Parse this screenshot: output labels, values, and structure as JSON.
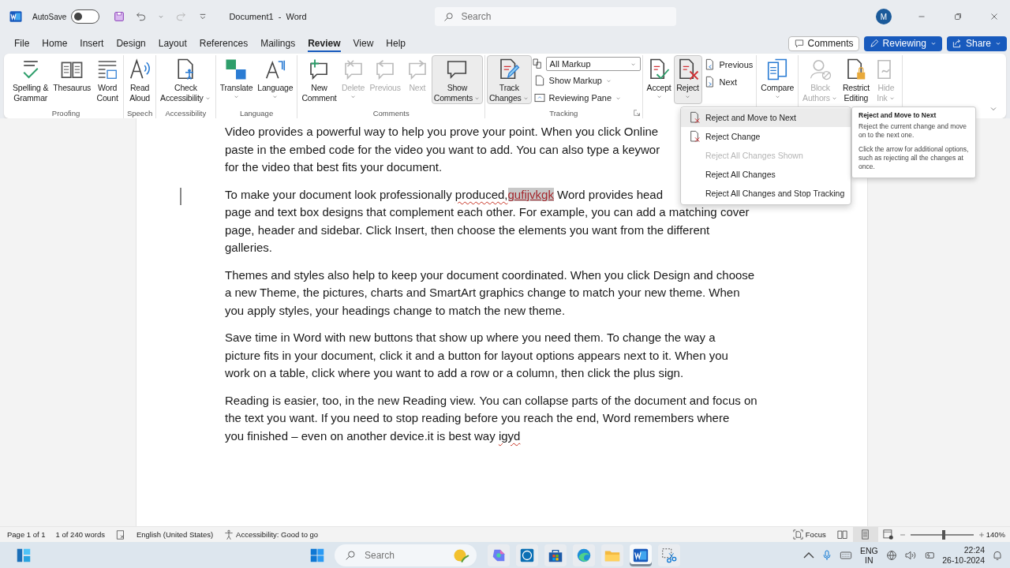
{
  "title_bar": {
    "autosave_label": "AutoSave",
    "autosave_on": false,
    "document_title": "Document1  -  Word",
    "search_placeholder": "Search",
    "account_initial": "M"
  },
  "menu_tabs": [
    {
      "label": "File",
      "selected": false
    },
    {
      "label": "Home",
      "selected": false
    },
    {
      "label": "Insert",
      "selected": false
    },
    {
      "label": "Design",
      "selected": false
    },
    {
      "label": "Layout",
      "selected": false
    },
    {
      "label": "References",
      "selected": false
    },
    {
      "label": "Mailings",
      "selected": false
    },
    {
      "label": "Review",
      "selected": true
    },
    {
      "label": "View",
      "selected": false
    },
    {
      "label": "Help",
      "selected": false
    }
  ],
  "header_buttons": [
    {
      "kind": "outline",
      "label": "Comments",
      "dropdown": false
    },
    {
      "kind": "primary",
      "label": "Reviewing",
      "dropdown": true
    },
    {
      "kind": "primary",
      "label": "Share",
      "dropdown": true
    }
  ],
  "ribbon_groups": [
    {
      "label": "Proofing",
      "items": [
        {
          "kind": "large",
          "lines": [
            "Spelling &",
            "Grammar"
          ],
          "dropdown": false,
          "disabled": false,
          "pressed": false
        },
        {
          "kind": "large",
          "lines": [
            "Thesaurus"
          ],
          "dropdown": false,
          "disabled": false,
          "pressed": false
        },
        {
          "kind": "large",
          "lines": [
            "Word",
            "Count"
          ],
          "dropdown": false,
          "disabled": false,
          "pressed": false
        }
      ]
    },
    {
      "label": "Speech",
      "items": [
        {
          "kind": "large",
          "lines": [
            "Read",
            "Aloud"
          ],
          "dropdown": false,
          "disabled": false,
          "pressed": false
        }
      ]
    },
    {
      "label": "Accessibility",
      "items": [
        {
          "kind": "large",
          "lines": [
            "Check",
            "Accessibility"
          ],
          "dropdown": true,
          "disabled": false,
          "pressed": false
        }
      ]
    },
    {
      "label": "Language",
      "items": [
        {
          "kind": "large",
          "lines": [
            "Translate"
          ],
          "dropdown": true,
          "disabled": false,
          "pressed": false
        },
        {
          "kind": "large",
          "lines": [
            "Language"
          ],
          "dropdown": true,
          "disabled": false,
          "pressed": false
        }
      ]
    },
    {
      "label": "Comments",
      "items": [
        {
          "kind": "large",
          "lines": [
            "New",
            "Comment"
          ],
          "dropdown": false,
          "disabled": false,
          "pressed": false
        },
        {
          "kind": "large",
          "lines": [
            "Delete"
          ],
          "dropdown": true,
          "disabled": true,
          "pressed": false
        },
        {
          "kind": "large",
          "lines": [
            "Previous"
          ],
          "dropdown": false,
          "disabled": true,
          "pressed": false
        },
        {
          "kind": "large",
          "lines": [
            "Next"
          ],
          "dropdown": false,
          "disabled": true,
          "pressed": false
        },
        {
          "kind": "large",
          "lines": [
            "Show",
            "Comments"
          ],
          "dropdown": true,
          "disabled": false,
          "pressed": true
        }
      ]
    },
    {
      "label": "Tracking",
      "launcher": true,
      "items": [
        {
          "kind": "large",
          "lines": [
            "Track",
            "Changes"
          ],
          "dropdown": true,
          "disabled": false,
          "pressed": true
        },
        {
          "kind": "stack",
          "items": [
            {
              "kind": "select",
              "label": "All Markup"
            },
            {
              "kind": "small",
              "label": "Show Markup",
              "caret": true
            },
            {
              "kind": "small",
              "label": "Reviewing Pane",
              "caret": true
            }
          ]
        }
      ]
    },
    {
      "items": [
        {
          "kind": "large",
          "lines": [
            "Accept"
          ],
          "dropdown": true,
          "disabled": false,
          "pressed": false
        },
        {
          "kind": "large",
          "lines": [
            "Reject"
          ],
          "dropdown": true,
          "disabled": false,
          "pressed": true
        },
        {
          "kind": "stack",
          "items": [
            {
              "kind": "small",
              "label": "Previous",
              "caret": false
            },
            {
              "kind": "small",
              "label": "Next",
              "caret": false
            }
          ]
        }
      ]
    },
    {
      "items": [
        {
          "kind": "large",
          "lines": [
            "Compare"
          ],
          "dropdown": true,
          "disabled": false,
          "pressed": false
        }
      ]
    },
    {
      "items": [
        {
          "kind": "large",
          "lines": [
            "Block",
            "Authors"
          ],
          "dropdown": true,
          "disabled": true,
          "pressed": false
        },
        {
          "kind": "large",
          "lines": [
            "Restrict",
            "Editing"
          ],
          "dropdown": false,
          "disabled": false,
          "pressed": false
        },
        {
          "kind": "large",
          "lines": [
            "Hide",
            "Ink"
          ],
          "dropdown": true,
          "disabled": true,
          "pressed": false
        }
      ]
    }
  ],
  "reject_menu": {
    "items": [
      {
        "label": "Reject and Move to Next",
        "has_icon": true,
        "disabled": false,
        "selected": true
      },
      {
        "label": "Reject Change",
        "has_icon": true,
        "disabled": false,
        "selected": false
      },
      {
        "label": "Reject All Changes Shown",
        "has_icon": false,
        "disabled": true,
        "selected": false
      },
      {
        "label": "Reject All Changes",
        "has_icon": false,
        "disabled": false,
        "selected": false
      },
      {
        "label": "Reject All Changes and Stop Tracking",
        "has_icon": false,
        "disabled": false,
        "selected": false
      }
    ]
  },
  "tooltip": {
    "title": "Reject and Move to Next",
    "paragraphs": [
      "Reject the current change and move on to the next one.",
      "Click the arrow for additional options, such as rejecting all the changes at once."
    ]
  },
  "document": {
    "paragraphs": [
      {
        "changed": false,
        "lines": [
          [
            {
              "kind": "text",
              "text": "Video provides a powerful way to help you prove your point. When you click Online"
            }
          ],
          [
            {
              "kind": "text",
              "text": "paste in the embed code for the video you want to add. You can also type a keywor"
            }
          ],
          [
            {
              "kind": "text",
              "text": "for the video that best fits your document."
            }
          ]
        ]
      },
      {
        "changed": true,
        "lines": [
          [
            {
              "kind": "text",
              "text": "To make your document look professionally "
            },
            {
              "kind": "misspelled",
              "text": "produced,"
            },
            {
              "kind": "insertion",
              "text": "gufijvkgk"
            },
            {
              "kind": "text",
              "text": " Word provides head"
            }
          ],
          [
            {
              "kind": "text",
              "text": "page and text box designs that complement each other. For example, you can add a matching cover"
            }
          ],
          [
            {
              "kind": "text",
              "text": "page, header and sidebar. Click Insert, then choose the elements you want from the different"
            }
          ],
          [
            {
              "kind": "text",
              "text": "galleries."
            }
          ]
        ]
      },
      {
        "changed": false,
        "lines": [
          [
            {
              "kind": "text",
              "text": "Themes and styles also help to keep your document coordinated. When you click Design and choose"
            }
          ],
          [
            {
              "kind": "text",
              "text": "a new Theme, the pictures, charts and SmartArt graphics change to match your new theme. When"
            }
          ],
          [
            {
              "kind": "text",
              "text": "you apply styles, your headings change to match the new theme."
            }
          ]
        ]
      },
      {
        "changed": false,
        "lines": [
          [
            {
              "kind": "text",
              "text": "Save time in Word with new buttons that show up where you need them. To change the way a"
            }
          ],
          [
            {
              "kind": "text",
              "text": "picture fits in your document, click it and a button for layout options appears next to it. When you"
            }
          ],
          [
            {
              "kind": "text",
              "text": "work on a table, click where you want to add a row or a column, then click the plus sign."
            }
          ]
        ]
      },
      {
        "changed": false,
        "lines": [
          [
            {
              "kind": "text",
              "text": "Reading is easier, too, in the new Reading view. You can collapse parts of the document and focus on"
            }
          ],
          [
            {
              "kind": "text",
              "text": "the text you want. If you need to stop reading before you reach the end, Word remembers where"
            }
          ],
          [
            {
              "kind": "text",
              "text": "you finished – even on another device.it is best way "
            },
            {
              "kind": "misspelled",
              "text": "igyd"
            }
          ]
        ]
      }
    ]
  },
  "status_bar": {
    "page": "Page 1 of 1",
    "words": "1 of 240 words",
    "language": "English (United States)",
    "accessibility": "Accessibility: Good to go",
    "focus": "Focus",
    "views": [
      {
        "selected": false
      },
      {
        "selected": true
      },
      {
        "selected": false
      }
    ],
    "zoom": {
      "level": 0.53,
      "reading": "140%"
    }
  },
  "taskbar": {
    "search_placeholder": "Search",
    "apps": [
      {
        "selected": false
      },
      {
        "selected": false
      },
      {
        "selected": false
      },
      {
        "selected": false
      },
      {
        "selected": false
      },
      {
        "selected": true
      },
      {
        "selected": false
      }
    ],
    "input_language": "ENG",
    "input_region": "IN",
    "time": "22:24",
    "date": "26-10-2024"
  }
}
